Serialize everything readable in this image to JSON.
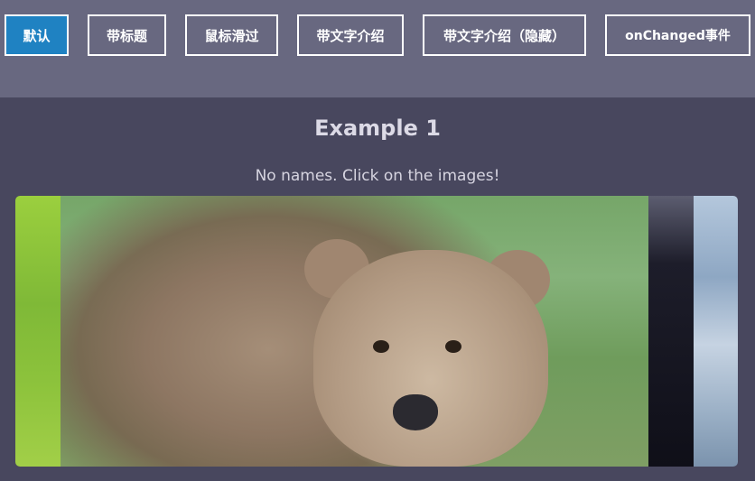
{
  "tabs": [
    {
      "label": "默认",
      "active": true
    },
    {
      "label": "带标题",
      "active": false
    },
    {
      "label": "鼠标滑过",
      "active": false
    },
    {
      "label": "带文字介绍",
      "active": false
    },
    {
      "label": "带文字介绍（隐藏）",
      "active": false
    },
    {
      "label": "onChanged事件",
      "active": false
    }
  ],
  "main": {
    "title": "Example 1",
    "subtitle": "No names. Click on the images!"
  },
  "gallery": {
    "images": [
      {
        "subject": "green-grass"
      },
      {
        "subject": "brown-bear",
        "expanded": true
      },
      {
        "subject": "dark-animal"
      },
      {
        "subject": "blue-sky-clouds"
      }
    ]
  },
  "colors": {
    "active_tab": "#1f82c2",
    "topbar": "#686880",
    "background": "#48475e"
  }
}
